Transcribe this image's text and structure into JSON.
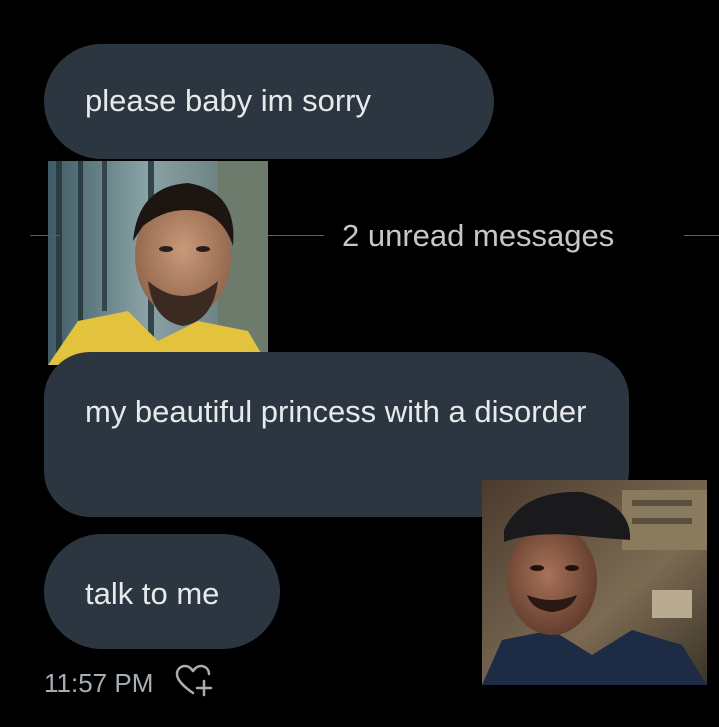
{
  "messages": [
    {
      "text": "please baby im sorry"
    },
    {
      "text": "my beautiful princess with a disorder"
    },
    {
      "text": "talk to me"
    }
  ],
  "divider": {
    "label": "2 unread messages"
  },
  "footer": {
    "timestamp": "11:57 PM",
    "reaction_icon": "heart-add-icon"
  },
  "colors": {
    "background": "#000000",
    "bubble": "#2b3640",
    "text": "#e7e9ea",
    "muted_text": "#a6adb3"
  }
}
